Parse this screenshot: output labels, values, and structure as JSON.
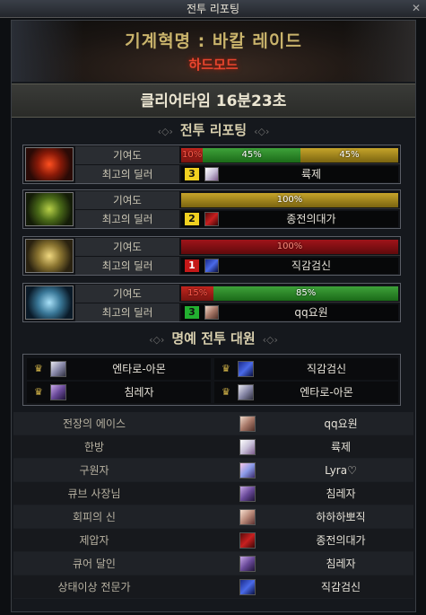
{
  "window": {
    "title": "전투 리포팅",
    "close_glyph": "✕"
  },
  "raid": {
    "title": "기계혁명 : 바칼 레이드",
    "mode": "하드모드"
  },
  "clear_time": "클리어타임  16분23초",
  "battle_section_title": "전투 리포팅",
  "players": [
    {
      "boss_icon": "red-flame-mask-icon",
      "contribution_label": "기여도",
      "segments": [
        {
          "label": "10%",
          "value": 10,
          "color": "red"
        },
        {
          "label": "45%",
          "value": 45,
          "color": "green"
        },
        {
          "label": "45%",
          "value": 45,
          "color": "yellow"
        }
      ],
      "dealer_label": "최고의 딜러",
      "rank": "3",
      "rank_color": "yellow",
      "dealer_name": "륙제"
    },
    {
      "boss_icon": "green-spiked-mask-icon",
      "contribution_label": "기여도",
      "segments": [
        {
          "label": "100%",
          "value": 100,
          "color": "yellow"
        }
      ],
      "dealer_label": "최고의 딜러",
      "rank": "2",
      "rank_color": "yellow",
      "dealer_name": "종전의대가"
    },
    {
      "boss_icon": "gold-horned-mask-icon",
      "contribution_label": "기여도",
      "segments": [
        {
          "label": "100%",
          "value": 100,
          "color": "red-full"
        }
      ],
      "dealer_label": "최고의 딜러",
      "rank": "1",
      "rank_color": "red",
      "dealer_name": "직감검신"
    },
    {
      "boss_icon": "blue-mech-mask-icon",
      "contribution_label": "기여도",
      "segments": [
        {
          "label": "15%",
          "value": 15,
          "color": "red"
        },
        {
          "label": "85%",
          "value": 85,
          "color": "green"
        }
      ],
      "dealer_label": "최고의 딜러",
      "rank": "3",
      "rank_color": "green",
      "dealer_name": "qq요원"
    }
  ],
  "honor_section_title": "명예 전투 대원",
  "honor": [
    {
      "name": "엔타로-아몬"
    },
    {
      "name": "직감검신"
    },
    {
      "name": "침레자"
    },
    {
      "name": "엔타로-아몬"
    }
  ],
  "awards": [
    {
      "label": "전장의 에이스",
      "name": "qq요원"
    },
    {
      "label": "한방",
      "name": "륙제"
    },
    {
      "label": "구원자",
      "name": "Lyra♡"
    },
    {
      "label": "큐브 사장님",
      "name": "침레자"
    },
    {
      "label": "회피의 신",
      "name": "하하하뽀직"
    },
    {
      "label": "제압자",
      "name": "종전의대가"
    },
    {
      "label": "큐어 달인",
      "name": "침레자"
    },
    {
      "label": "상태이상 전문가",
      "name": "직감검신"
    }
  ],
  "colors": {
    "bar_red": "#c4261e",
    "bar_green": "#3ea23a",
    "bar_yellow": "#c6a42a",
    "title_gold": "#c9b36b",
    "hard_mode_red": "#e8452e"
  }
}
